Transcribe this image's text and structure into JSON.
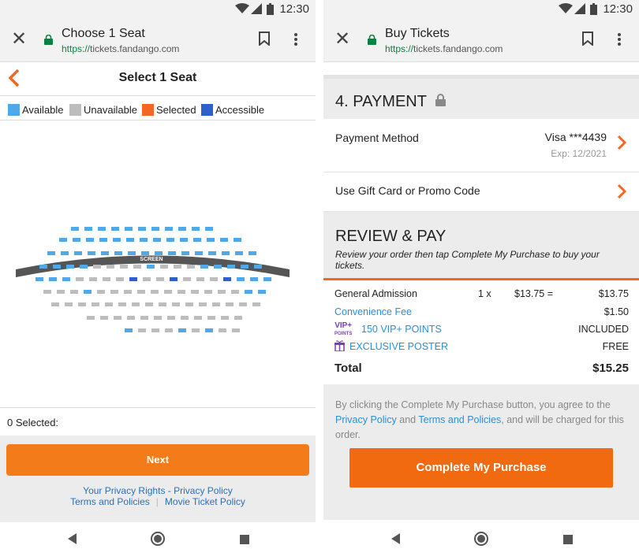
{
  "status": {
    "time": "12:30"
  },
  "left": {
    "browser": {
      "title": "Choose 1 Seat",
      "url_scheme": "https://",
      "url_host": "tickets.fandango.com"
    },
    "page_title": "Select 1 Seat",
    "legend": [
      {
        "label": "Available",
        "color": "#4fa8e8"
      },
      {
        "label": "Unavailable",
        "color": "#bdbdbd"
      },
      {
        "label": "Selected",
        "color": "#f26722"
      },
      {
        "label": "Accessible",
        "color": "#2f5fc9"
      }
    ],
    "screen_label": "SCREEN",
    "selected_text": "0 Selected:",
    "next_label": "Next",
    "links": {
      "privacy_rights": "Your Privacy Rights",
      "dash": " - ",
      "privacy_policy": "Privacy Policy",
      "terms": "Terms and Policies",
      "movie_policy": "Movie Ticket Policy"
    }
  },
  "right": {
    "browser": {
      "title": "Buy Tickets",
      "url_scheme": "https://",
      "url_host": "tickets.fandango.com"
    },
    "payment_heading": "4. PAYMENT",
    "payment_method_label": "Payment Method",
    "card": "Visa ***4439",
    "expiry": "Exp: 12/2021",
    "gift_label": "Use Gift Card or Promo Code",
    "review_heading": "REVIEW & PAY",
    "review_sub": "Review your order then tap Complete My Purchase to buy your tickets.",
    "lines": {
      "admission": "General Admission",
      "qty": "1 x",
      "unit": "$13.75 =",
      "admission_total": "$13.75",
      "fee": "Convenience Fee",
      "fee_amount": "$1.50",
      "vip": "150 VIP+ POINTS",
      "vip_status": "INCLUDED",
      "vip_logo_top": "VIP+",
      "vip_logo_bottom": "POINTS",
      "poster": "EXCLUSIVE POSTER",
      "poster_status": "FREE",
      "total_label": "Total",
      "total_amount": "$15.25"
    },
    "terms": {
      "pre": "By clicking the Complete My Purchase button, you agree to the ",
      "privacy": "Privacy Policy",
      "and": " and ",
      "terms": "Terms and Policies",
      "post": ", and will be charged for this order."
    },
    "purchase_label": "Complete My Purchase"
  }
}
